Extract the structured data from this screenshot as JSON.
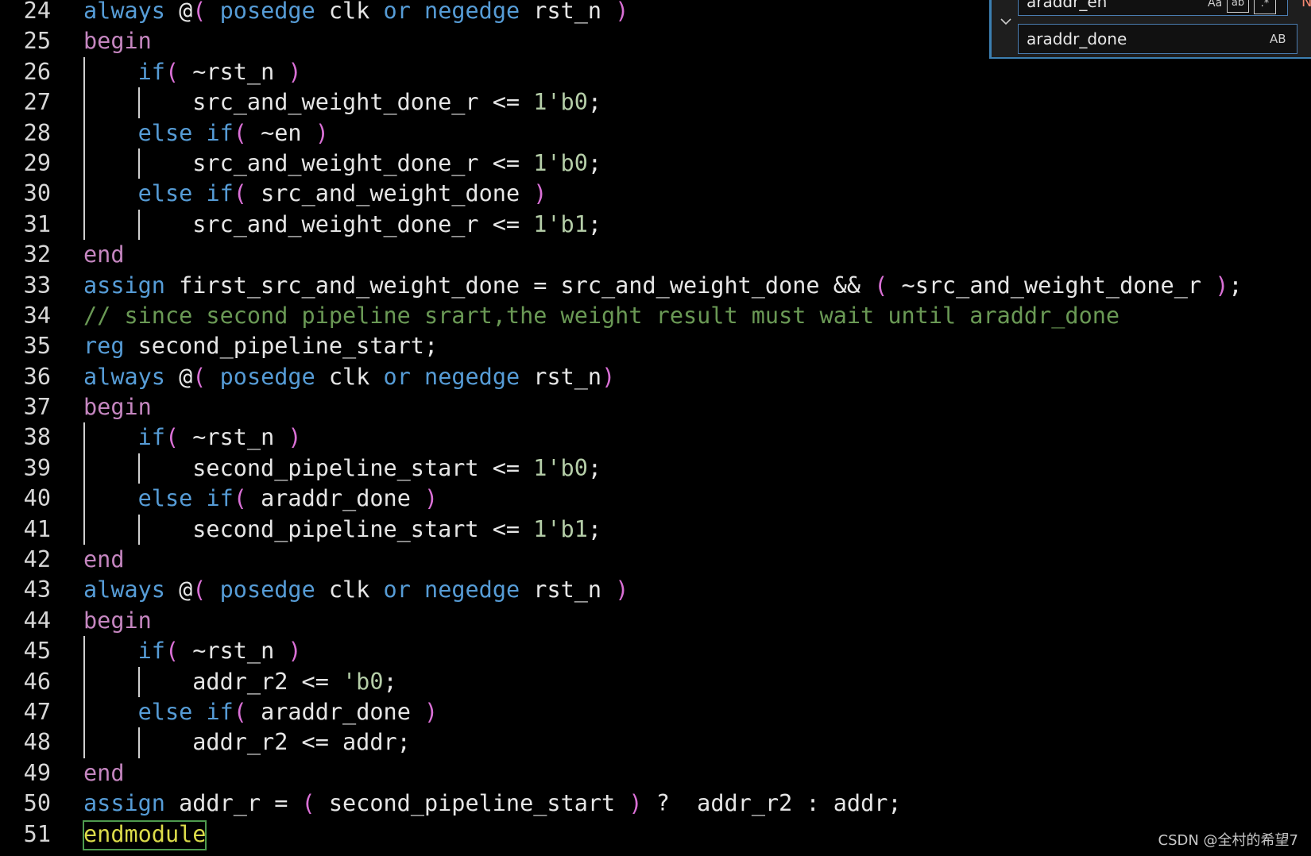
{
  "colors": {
    "background": "#000000",
    "keyword": "#569cd6",
    "control": "#c586c0",
    "number": "#b5cea8",
    "comment": "#6a9955",
    "bracket": "#da70d6",
    "identifier": "#e6e6e6",
    "line_number": "#d7d7d7"
  },
  "editor": {
    "lines": [
      {
        "n": "24",
        "guides": 0,
        "tokens": [
          [
            "kw",
            "always"
          ],
          [
            "id",
            " @"
          ],
          [
            "br",
            "("
          ],
          [
            "id",
            " "
          ],
          [
            "kw",
            "posedge"
          ],
          [
            "id",
            " clk "
          ],
          [
            "kw",
            "or"
          ],
          [
            "id",
            " "
          ],
          [
            "kw",
            "negedge"
          ],
          [
            "id",
            " rst_n "
          ],
          [
            "br",
            ")"
          ]
        ]
      },
      {
        "n": "25",
        "guides": 0,
        "tokens": [
          [
            "ctl",
            "begin"
          ]
        ]
      },
      {
        "n": "26",
        "guides": 1,
        "tokens": [
          [
            "id",
            "    "
          ],
          [
            "kw",
            "if"
          ],
          [
            "br",
            "("
          ],
          [
            "id",
            " ~rst_n "
          ],
          [
            "br",
            ")"
          ]
        ]
      },
      {
        "n": "27",
        "guides": 2,
        "tokens": [
          [
            "id",
            "        src_and_weight_done_r <= "
          ],
          [
            "num",
            "1'b0"
          ],
          [
            "id",
            ";"
          ]
        ]
      },
      {
        "n": "28",
        "guides": 1,
        "tokens": [
          [
            "id",
            "    "
          ],
          [
            "kw",
            "else"
          ],
          [
            "id",
            " "
          ],
          [
            "kw",
            "if"
          ],
          [
            "br",
            "("
          ],
          [
            "id",
            " ~en "
          ],
          [
            "br",
            ")"
          ]
        ]
      },
      {
        "n": "29",
        "guides": 2,
        "tokens": [
          [
            "id",
            "        src_and_weight_done_r <= "
          ],
          [
            "num",
            "1'b0"
          ],
          [
            "id",
            ";"
          ]
        ]
      },
      {
        "n": "30",
        "guides": 1,
        "tokens": [
          [
            "id",
            "    "
          ],
          [
            "kw",
            "else"
          ],
          [
            "id",
            " "
          ],
          [
            "kw",
            "if"
          ],
          [
            "br",
            "("
          ],
          [
            "id",
            " src_and_weight_done "
          ],
          [
            "br",
            ")"
          ]
        ]
      },
      {
        "n": "31",
        "guides": 2,
        "tokens": [
          [
            "id",
            "        src_and_weight_done_r <= "
          ],
          [
            "num",
            "1'b1"
          ],
          [
            "id",
            ";"
          ]
        ]
      },
      {
        "n": "32",
        "guides": 0,
        "tokens": [
          [
            "ctl",
            "end"
          ]
        ]
      },
      {
        "n": "33",
        "guides": 0,
        "tokens": [
          [
            "kw",
            "assign"
          ],
          [
            "id",
            " first_src_and_weight_done = src_and_weight_done && "
          ],
          [
            "br",
            "("
          ],
          [
            "id",
            " ~src_and_weight_done_r "
          ],
          [
            "br",
            ")"
          ],
          [
            "id",
            ";"
          ]
        ]
      },
      {
        "n": "34",
        "guides": 0,
        "tokens": [
          [
            "cm",
            "// since second pipeline srart,the weight result must wait until araddr_done"
          ]
        ]
      },
      {
        "n": "35",
        "guides": 0,
        "tokens": [
          [
            "kw",
            "reg"
          ],
          [
            "id",
            " second_pipeline_start;"
          ]
        ]
      },
      {
        "n": "36",
        "guides": 0,
        "tokens": [
          [
            "kw",
            "always"
          ],
          [
            "id",
            " @"
          ],
          [
            "br",
            "("
          ],
          [
            "id",
            " "
          ],
          [
            "kw",
            "posedge"
          ],
          [
            "id",
            " clk "
          ],
          [
            "kw",
            "or"
          ],
          [
            "id",
            " "
          ],
          [
            "kw",
            "negedge"
          ],
          [
            "id",
            " rst_n"
          ],
          [
            "br",
            ")"
          ]
        ]
      },
      {
        "n": "37",
        "guides": 0,
        "tokens": [
          [
            "ctl",
            "begin"
          ]
        ]
      },
      {
        "n": "38",
        "guides": 1,
        "tokens": [
          [
            "id",
            "    "
          ],
          [
            "kw",
            "if"
          ],
          [
            "br",
            "("
          ],
          [
            "id",
            " ~rst_n "
          ],
          [
            "br",
            ")"
          ]
        ]
      },
      {
        "n": "39",
        "guides": 2,
        "tokens": [
          [
            "id",
            "        second_pipeline_start <= "
          ],
          [
            "num",
            "1'b0"
          ],
          [
            "id",
            ";"
          ]
        ]
      },
      {
        "n": "40",
        "guides": 1,
        "tokens": [
          [
            "id",
            "    "
          ],
          [
            "kw",
            "else"
          ],
          [
            "id",
            " "
          ],
          [
            "kw",
            "if"
          ],
          [
            "br",
            "("
          ],
          [
            "id",
            " araddr_done "
          ],
          [
            "br",
            ")"
          ]
        ]
      },
      {
        "n": "41",
        "guides": 2,
        "tokens": [
          [
            "id",
            "        second_pipeline_start <= "
          ],
          [
            "num",
            "1'b1"
          ],
          [
            "id",
            ";"
          ]
        ]
      },
      {
        "n": "42",
        "guides": 0,
        "tokens": [
          [
            "ctl",
            "end"
          ]
        ]
      },
      {
        "n": "43",
        "guides": 0,
        "tokens": [
          [
            "kw",
            "always"
          ],
          [
            "id",
            " @"
          ],
          [
            "br",
            "("
          ],
          [
            "id",
            " "
          ],
          [
            "kw",
            "posedge"
          ],
          [
            "id",
            " clk "
          ],
          [
            "kw",
            "or"
          ],
          [
            "id",
            " "
          ],
          [
            "kw",
            "negedge"
          ],
          [
            "id",
            " rst_n "
          ],
          [
            "br",
            ")"
          ]
        ]
      },
      {
        "n": "44",
        "guides": 0,
        "tokens": [
          [
            "ctl",
            "begin"
          ]
        ]
      },
      {
        "n": "45",
        "guides": 1,
        "tokens": [
          [
            "id",
            "    "
          ],
          [
            "kw",
            "if"
          ],
          [
            "br",
            "("
          ],
          [
            "id",
            " ~rst_n "
          ],
          [
            "br",
            ")"
          ]
        ]
      },
      {
        "n": "46",
        "guides": 2,
        "tokens": [
          [
            "id",
            "        addr_r2 <= "
          ],
          [
            "num",
            "'b0"
          ],
          [
            "id",
            ";"
          ]
        ]
      },
      {
        "n": "47",
        "guides": 1,
        "tokens": [
          [
            "id",
            "    "
          ],
          [
            "kw",
            "else"
          ],
          [
            "id",
            " "
          ],
          [
            "kw",
            "if"
          ],
          [
            "br",
            "("
          ],
          [
            "id",
            " araddr_done "
          ],
          [
            "br",
            ")"
          ]
        ]
      },
      {
        "n": "48",
        "guides": 2,
        "tokens": [
          [
            "id",
            "        addr_r2 <= addr;"
          ]
        ]
      },
      {
        "n": "49",
        "guides": 0,
        "tokens": [
          [
            "ctl",
            "end"
          ]
        ]
      },
      {
        "n": "50",
        "guides": 0,
        "tokens": [
          [
            "kw",
            "assign"
          ],
          [
            "id",
            " addr_r = "
          ],
          [
            "br",
            "("
          ],
          [
            "id",
            " second_pipeline_start "
          ],
          [
            "br",
            ")"
          ],
          [
            "id",
            " ?  addr_r2 : addr;"
          ]
        ]
      },
      {
        "n": "51",
        "guides": 0,
        "tokens": [
          [
            "endmod",
            "endmodule"
          ]
        ]
      }
    ]
  },
  "find_widget": {
    "find_value": "araddr_en",
    "replace_value": "araddr_done",
    "match_case_label": "Aa",
    "whole_word_label": "ab",
    "regex_label": ".*",
    "preserve_case_label": "AB",
    "result_label": "No",
    "toggle_icon": "chevron-down-icon"
  },
  "watermark": "CSDN @全村的希望7"
}
